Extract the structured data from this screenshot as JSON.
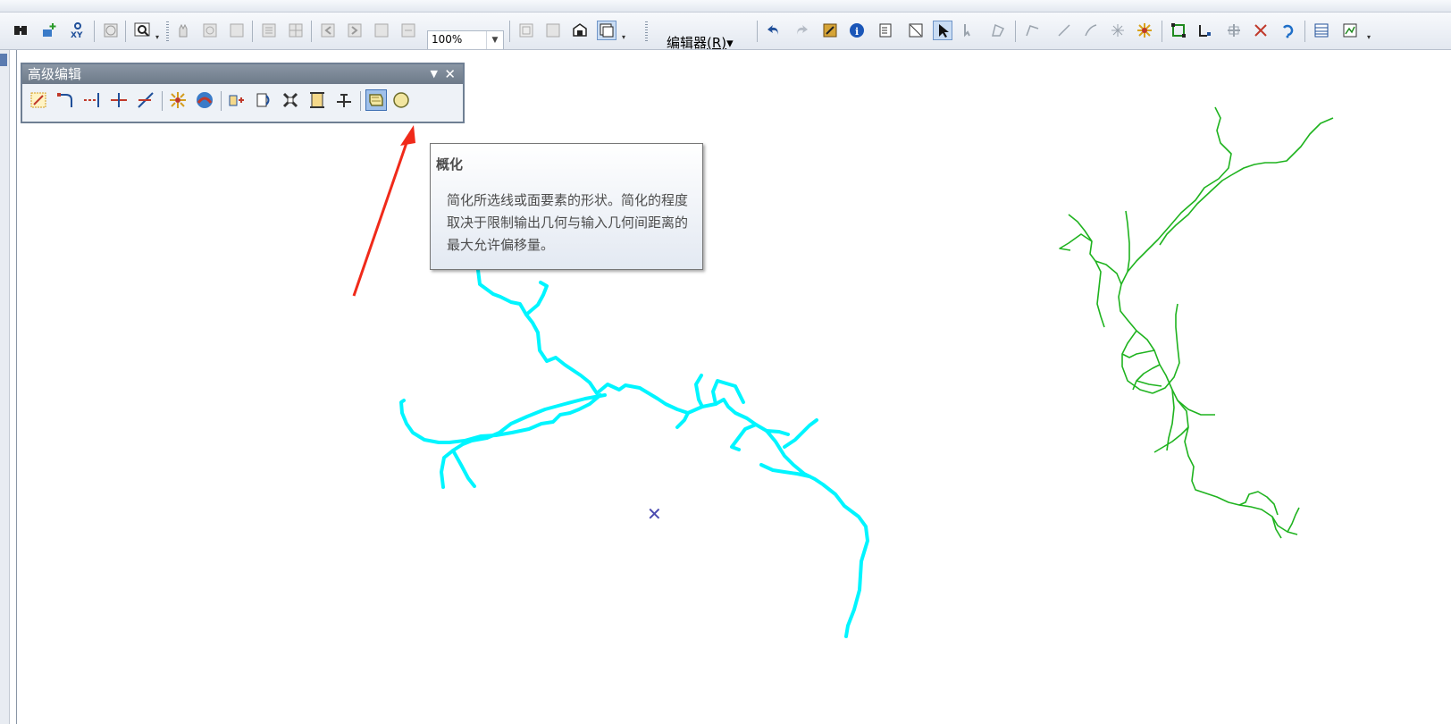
{
  "toolbar_top": {
    "zoom_value": "100%",
    "editor_menu_label": "编辑器",
    "editor_menu_accel": "(R)",
    "editor_menu_arrow": "▾"
  },
  "advanced_editing_toolbar": {
    "title": "高级编辑",
    "pin_glyph": "▼",
    "close_glyph": "✕"
  },
  "tooltip": {
    "title": "概化",
    "body": "简化所选线或面要素的形状。简化的程度取决于限制输出几何与输入几何间距离的最大允许偏移量。"
  },
  "map": {
    "center_marker_glyph": "✕"
  },
  "colors": {
    "selected_feature": "#00f5ff",
    "unselected_feature": "#1fb31f",
    "annotation_arrow": "#f02a1a",
    "center_marker": "#4a4ab0",
    "tooltip_text": "#4c4c4c"
  },
  "icons": {
    "toolbar_row_2": [
      "find-icon",
      "go-to-xy-add-icon",
      "go-to-xy-icon",
      "clock-icon",
      "zoom-box-icon",
      "pan-icon",
      "full-extent-icon",
      "fixed-zoom-in-icon",
      "fixed-zoom-out-icon",
      "zoom-grid-icon",
      "back-icon",
      "forward-icon",
      "layout-page-icon",
      "layout-extent-icon",
      "layout-identify-icon",
      "layout-select-icon",
      "undo-icon",
      "redo-icon",
      "editor-toolbar-icon",
      "info-icon",
      "attributes-icon",
      "sketch-properties-icon",
      "edit-tool-icon",
      "annotation-tool-icon",
      "reshape-icon",
      "edit-vertices-icon",
      "line-segment-icon",
      "arc-icon",
      "trace-icon",
      "spark-icon",
      "topology-icon",
      "topology-edit-icon",
      "split-icon",
      "cut-icon",
      "rotate-icon",
      "table-icon",
      "chart-icon"
    ],
    "advanced_toolbar": [
      "copy-parallel-icon",
      "fillet-icon",
      "extend-icon",
      "trim-icon",
      "line-intersection-icon",
      "explode-icon",
      "construct-geodesic-icon",
      "align-edge-icon",
      "replace-geometry-icon",
      "smooth-icon",
      "construct-polygons-icon",
      "split-polygons-icon",
      "generalize-icon",
      "smooth-polygon-icon"
    ]
  }
}
